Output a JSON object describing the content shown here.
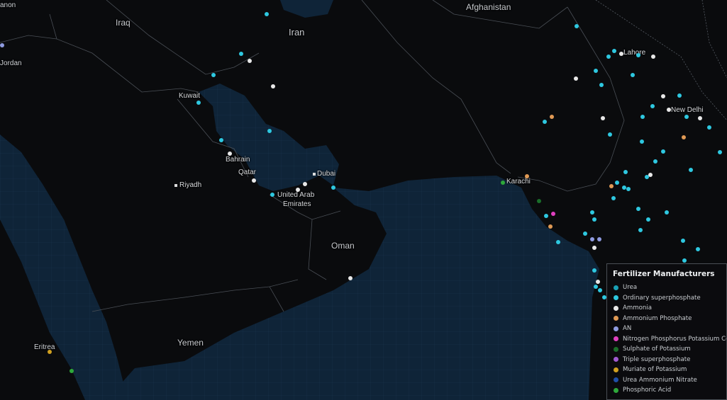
{
  "map": {
    "labels": {
      "afghanistan": "Afghanistan",
      "iraq": "Iraq",
      "iran": "Iran",
      "jordan": "Jordan",
      "lebanon": "anon",
      "kuwait": "Kuwait",
      "bahrain": "Bahrain",
      "qatar": "Qatar",
      "riyadh": "Riyadh",
      "dubai": "Dubai",
      "uae_line1": "United Arab",
      "uae_line2": "Emirates",
      "oman": "Oman",
      "yemen": "Yemen",
      "eritrea": "Eritrea",
      "karachi": "Karachi",
      "lahore": "Lahore",
      "new_delhi": "New Delhi"
    }
  },
  "legend": {
    "title": "Fertilizer Manufacturers",
    "items": [
      {
        "label": "Urea",
        "color": "#1aa0b4"
      },
      {
        "label": "Ordinary superphosphate",
        "color": "#2ec8e0"
      },
      {
        "label": "Ammonia",
        "color": "#e8e8e8"
      },
      {
        "label": "Ammonium Phosphate",
        "color": "#e09a55"
      },
      {
        "label": "AN",
        "color": "#8f9be0"
      },
      {
        "label": "Nitrogen Phosphorus Potassium Compound",
        "color": "#e040c0"
      },
      {
        "label": "Sulphate of Potassium",
        "color": "#1a6e2a"
      },
      {
        "label": "Triple superphosphate",
        "color": "#a05ad0"
      },
      {
        "label": "Muriate of Potassium",
        "color": "#d0a020"
      },
      {
        "label": "Urea Ammonium Nitrate",
        "color": "#1f4fa8"
      },
      {
        "label": "Phosphoric Acid",
        "color": "#2ea83a"
      }
    ]
  }
}
